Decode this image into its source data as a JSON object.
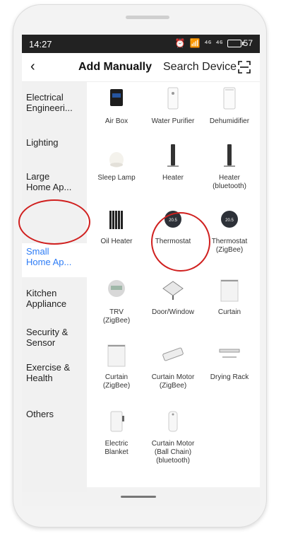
{
  "status": {
    "time": "14:27",
    "signal1": "⁴⁶",
    "signal2": "⁴⁶",
    "battery": "57"
  },
  "header": {
    "back_icon": "back-arrow-icon",
    "tab_manual": "Add Manually",
    "tab_search": "Search Device",
    "scan_icon": "scan-icon"
  },
  "sidebar": {
    "items": [
      {
        "label": "Electrical\nEngineeri..."
      },
      {
        "label": "Lighting"
      },
      {
        "label": "Large\nHome Ap..."
      },
      {
        "label": "Small\nHome Ap..."
      },
      {
        "label": "Kitchen\nAppliance"
      },
      {
        "label": "Security &\nSensor"
      },
      {
        "label": "Exercise &\nHealth"
      },
      {
        "label": "Others"
      }
    ]
  },
  "devices": [
    {
      "label": "Air Box"
    },
    {
      "label": "Water Purifier"
    },
    {
      "label": "Dehumidifier"
    },
    {
      "label": "Sleep Lamp"
    },
    {
      "label": "Heater"
    },
    {
      "label": "Heater\n(bluetooth)"
    },
    {
      "label": "Oil Heater"
    },
    {
      "label": "Thermostat"
    },
    {
      "label": "Thermostat\n(ZigBee)"
    },
    {
      "label": "TRV\n(ZigBee)"
    },
    {
      "label": "Door/Window"
    },
    {
      "label": "Curtain"
    },
    {
      "label": "Curtain\n(ZigBee)"
    },
    {
      "label": "Curtain Motor\n(ZigBee)"
    },
    {
      "label": "Drying Rack"
    },
    {
      "label": "Electric\nBlanket"
    },
    {
      "label": "Curtain Motor\n(Ball Chain)\n(bluetooth)"
    }
  ],
  "colors": {
    "accent": "#2d7cf6",
    "annotation": "#d0201f"
  }
}
